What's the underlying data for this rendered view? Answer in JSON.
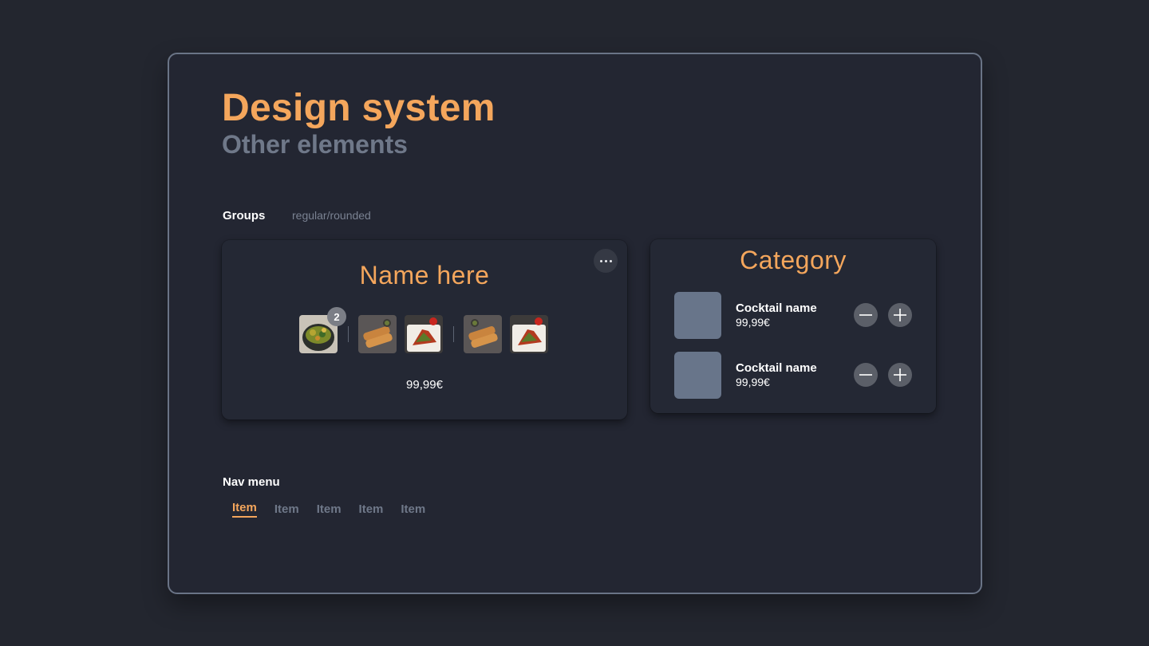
{
  "header": {
    "title": "Design system",
    "subtitle": "Other elements"
  },
  "groups_section": {
    "label": "Groups",
    "sublabel": "regular/rounded"
  },
  "group_card": {
    "name": "Name here",
    "badge_count": "2",
    "price": "99,99€",
    "more_icon": "more-horizontal-icon"
  },
  "category_card": {
    "title": "Category",
    "items": [
      {
        "name": "Cocktail name",
        "price": "99,99€"
      },
      {
        "name": "Cocktail name",
        "price": "99,99€"
      }
    ],
    "minus_icon": "minus-icon",
    "plus_icon": "plus-icon"
  },
  "nav_section": {
    "label": "Nav menu",
    "items": [
      "Item",
      "Item",
      "Item",
      "Item",
      "Item"
    ],
    "active_index": 0
  },
  "colors": {
    "background": "#23262f",
    "accent": "#f4a65c",
    "muted": "#6f7889",
    "card": "#242834",
    "placeholder": "#68758a"
  }
}
